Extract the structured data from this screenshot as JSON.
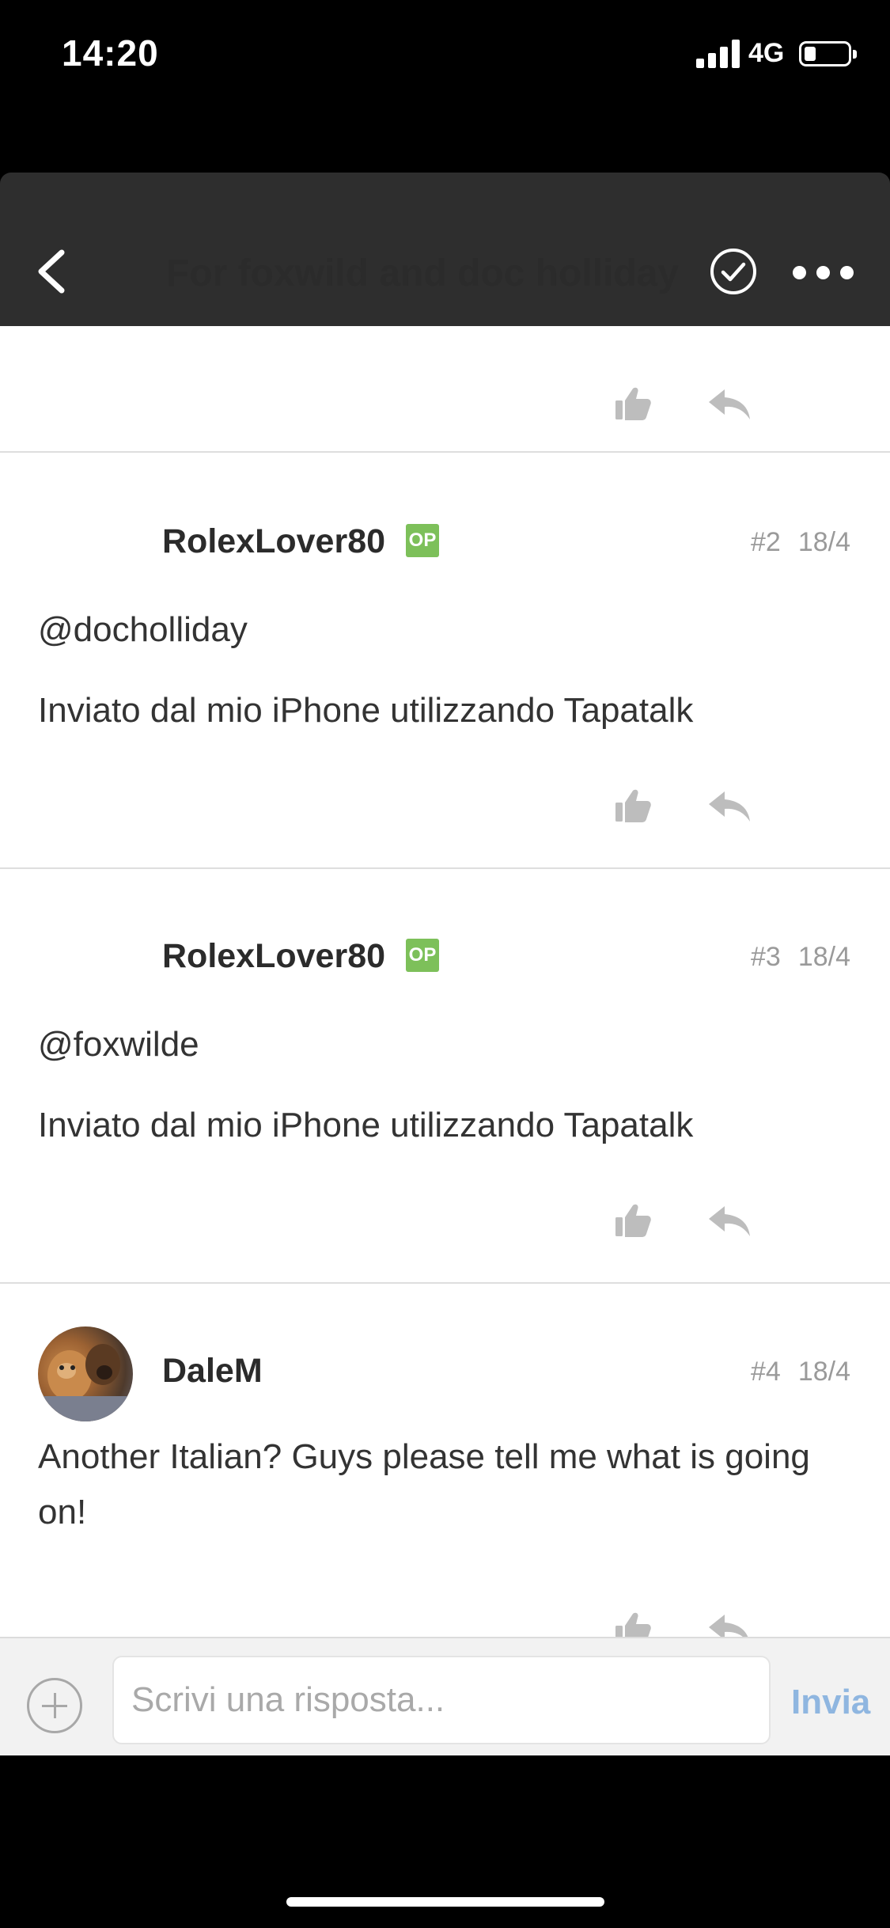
{
  "status_bar": {
    "time": "14:20",
    "network": "4G"
  },
  "header": {
    "title": "For foxwild and doc holliday"
  },
  "posts": [
    {
      "username": "RolexLover80",
      "op_badge": "OP",
      "number": "#2",
      "date": "18/4",
      "lines": [
        "@docholliday",
        "Inviato dal mio iPhone utilizzando Tapatalk"
      ]
    },
    {
      "username": "RolexLover80",
      "op_badge": "OP",
      "number": "#3",
      "date": "18/4",
      "lines": [
        "@foxwilde",
        "Inviato dal mio iPhone utilizzando Tapatalk"
      ]
    },
    {
      "username": "DaleM",
      "number": "#4",
      "date": "18/4",
      "lines": [
        "Another Italian? Guys please tell me what is going on!"
      ]
    }
  ],
  "composer": {
    "placeholder": "Scrivi una risposta...",
    "send_label": "Invia"
  },
  "colors": {
    "op_badge": "#7dc05a",
    "send": "#8fb6e0",
    "header": "#2e2e2e"
  }
}
